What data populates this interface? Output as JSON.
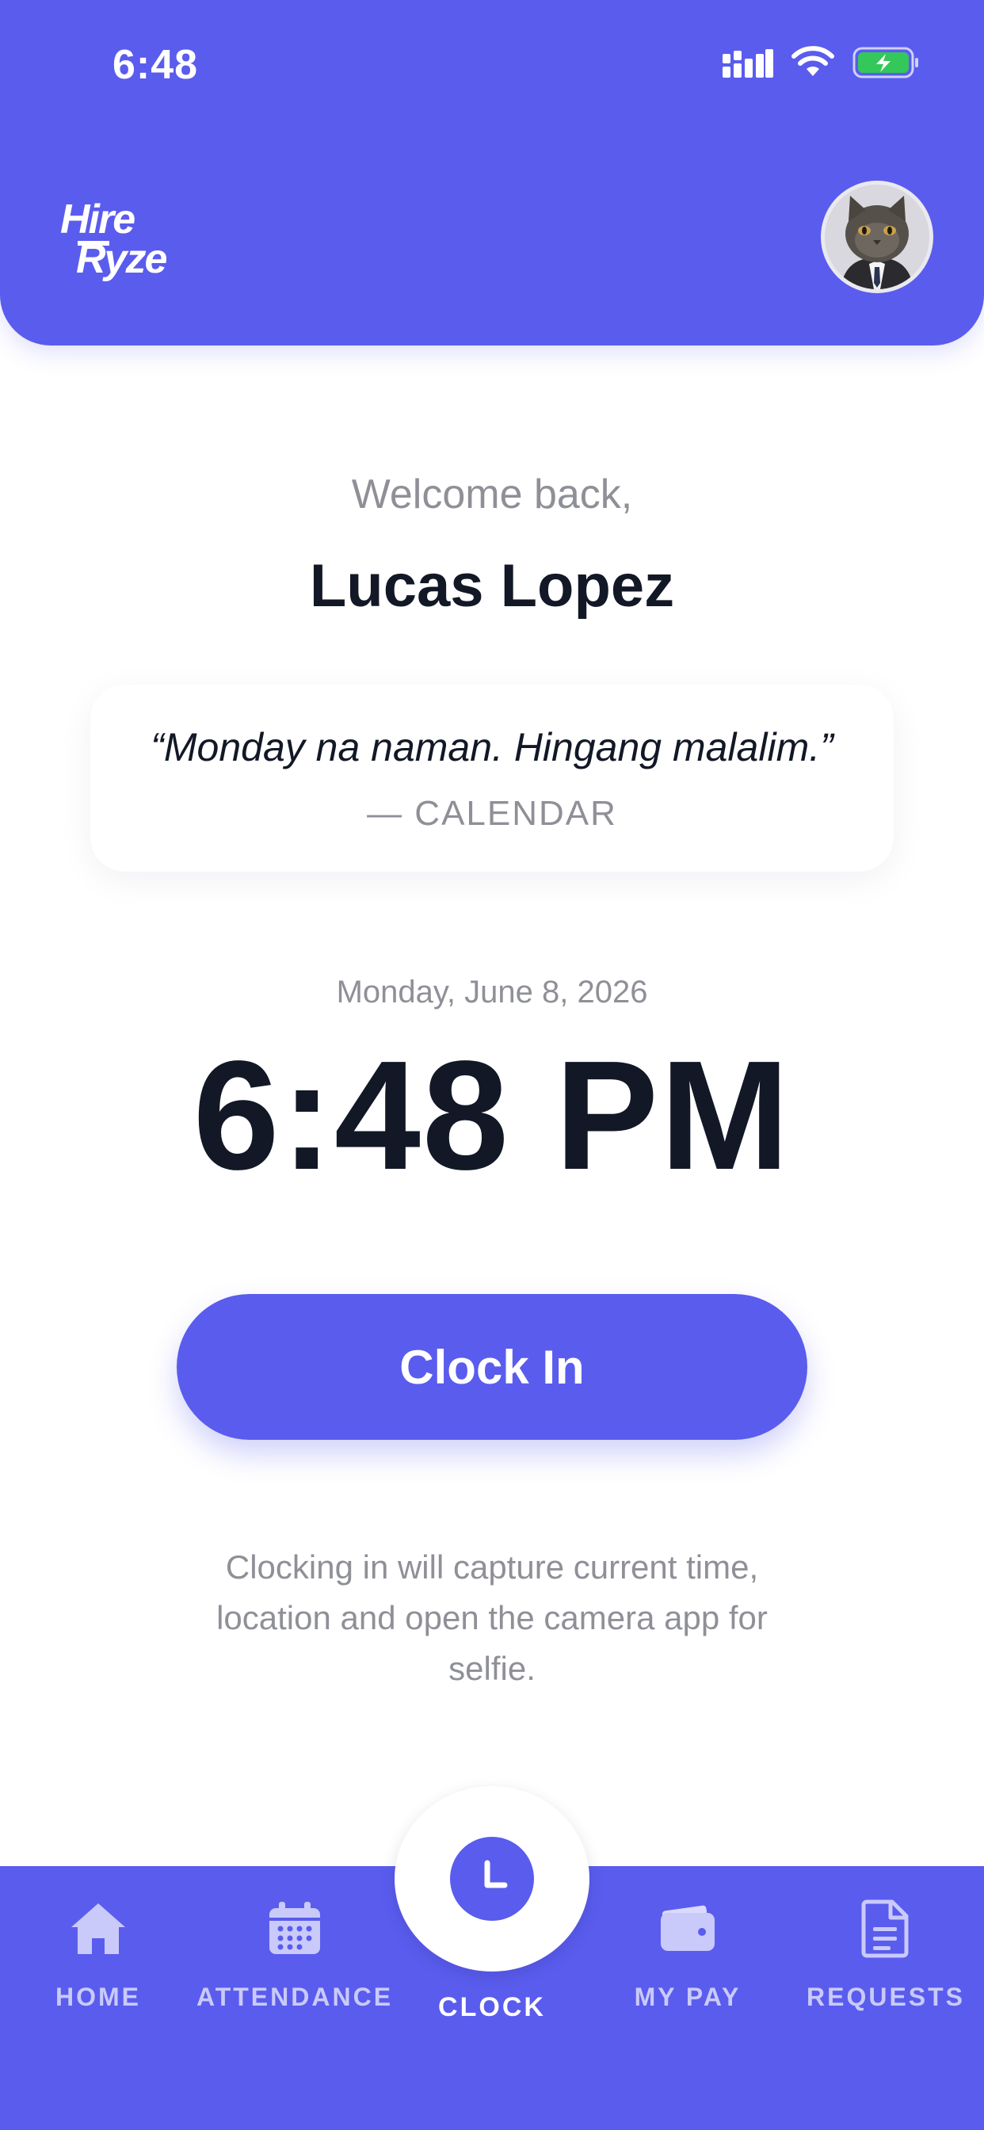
{
  "status_bar": {
    "time": "6:48",
    "icons": [
      "cellular-signal-icon",
      "wifi-icon",
      "battery-charging-icon"
    ]
  },
  "header": {
    "logo_text": "Hire Ryze",
    "avatar": "user-avatar-cat"
  },
  "greeting": {
    "welcome": "Welcome back,",
    "name": "Lucas Lopez"
  },
  "quote": {
    "text": "“Monday na naman. Hingang malalim.”",
    "author": "— CALENDAR"
  },
  "clock": {
    "date": "Monday, June 8, 2026",
    "time": "6:48 PM",
    "clock_in_label": "Clock In",
    "info": "Clocking in will capture current time, location and open the camera app for selfie."
  },
  "bottom_nav": {
    "items": [
      {
        "label": "HOME",
        "icon": "home-icon"
      },
      {
        "label": "ATTENDANCE",
        "icon": "calendar-icon"
      },
      {
        "label": "CLOCK",
        "icon": "clock-icon",
        "active": true
      },
      {
        "label": "MY PAY",
        "icon": "wallet-icon"
      },
      {
        "label": "REQUESTS",
        "icon": "document-icon"
      }
    ]
  },
  "colors": {
    "primary": "#5A5CEE",
    "text_dark": "#121826",
    "text_muted": "#8F9097",
    "nav_inactive": "#C9CAFA",
    "battery_green": "#34C759"
  }
}
